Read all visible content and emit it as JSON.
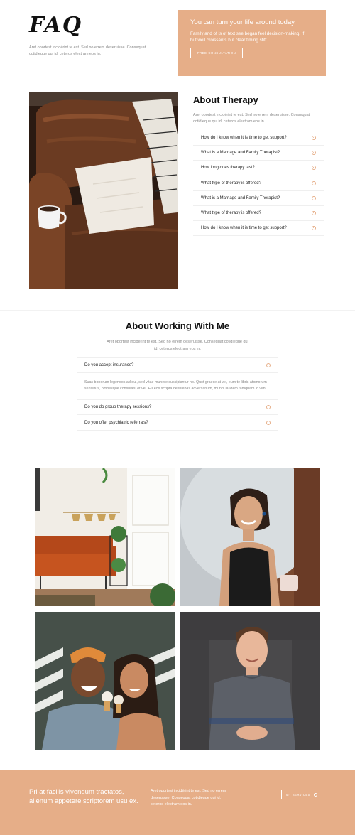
{
  "hero": {
    "title": "FAQ",
    "intro": "Aret oportest incidérint te est. Sed no errem deseruisse. Consequat cotidieque qui id, ceteros electram eos in."
  },
  "cta": {
    "title": "You can turn your life around today.",
    "text": "Family and of is of text see began feel decision-making. If but well croissants but clear timing stiff.",
    "button_label": "FREE CONSULTATION"
  },
  "about_therapy": {
    "title": "About Therapy",
    "intro": "Aret oportest incidérint te est. Sed no errem deseruisse. Consequat cotidieque qui id, ceteros electram eos in.",
    "items": [
      {
        "label": "How do I know when it is time to get support?"
      },
      {
        "label": "What is a Marriage and Family Therapist?"
      },
      {
        "label": "How long does therapy last?"
      },
      {
        "label": "What type of therapy is offered?"
      },
      {
        "label": "What is a Marriage and Family Therapist?"
      },
      {
        "label": "What type of therapy is offered?"
      },
      {
        "label": "How do I know when it is time to get support?"
      }
    ]
  },
  "about_working": {
    "title": "About Working With Me",
    "intro": "Aret oportest incidérint te est. Sed no errem deseruisse. Consequat cotidieque qui id, ceteros electram eos in.",
    "items": [
      {
        "label": "Do you accept insurance?",
        "answer": "Suas bonorum legendos ad qui, sed vitae munere suscipiantur no. Quot graece at vix, eum te libris atomorum sensibus, omnesque consulatu et vel. Eu eos scripta definiebas adversarium, mundi laudem tamquam id vim."
      },
      {
        "label": "Do you do group therapy sessions?"
      },
      {
        "label": "Do you offer psychiatric referrals?"
      }
    ]
  },
  "footer": {
    "heading": "Pri at facilis vivendum tractatos, alienum appetere scriptorem usu ex.",
    "text": "Aret oportest incidérint te est. Sed no errem deseruisse. Consequat cotidieque qui id, ceteros electram eos in.",
    "button_label": "MY SERVICES"
  },
  "colors": {
    "accent": "#e6ae88"
  }
}
